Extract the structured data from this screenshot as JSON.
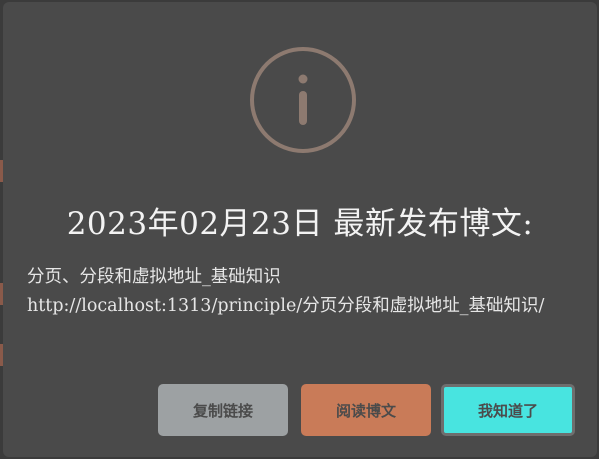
{
  "dialog": {
    "title": "2023年02月23日 最新发布博文:",
    "post_title": "分页、分段和虚拟地址_基础知识",
    "post_url": "http://localhost:1313/principle/分页分段和虚拟地址_基础知识/",
    "icon": "info-icon"
  },
  "buttons": {
    "copy_link": "复制链接",
    "read_post": "阅读博文",
    "got_it": "我知道了"
  },
  "colors": {
    "modal_bg": "#4a4a4a",
    "icon": "#8d7a70",
    "copy_button": "#9da1a3",
    "read_button": "#c97b58",
    "ok_button": "#48e4e0"
  }
}
